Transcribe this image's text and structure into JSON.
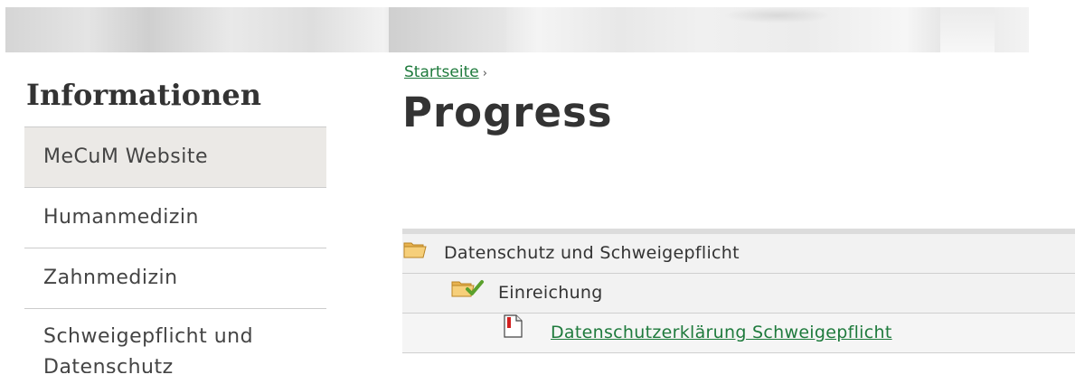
{
  "sidebar": {
    "heading": "Informationen",
    "items": [
      {
        "label": "MeCuM Website",
        "active": true
      },
      {
        "label": "Humanmedizin",
        "active": false
      },
      {
        "label": "Zahnmedizin",
        "active": false
      },
      {
        "label": "Schweigepflicht und Datenschutz",
        "active": false
      }
    ]
  },
  "breadcrumb": {
    "home": "Startseite",
    "separator": "›"
  },
  "page": {
    "title": "Progress"
  },
  "tree": {
    "rows": [
      {
        "label": "Datenschutz und Schweigepflicht",
        "icon": "folder-open-icon"
      },
      {
        "label": "Einreichung",
        "icon": "folder-check-icon"
      },
      {
        "label": "Datenschutzerklärung Schweigepflicht",
        "icon": "document-icon",
        "is_link": true
      }
    ]
  },
  "colors": {
    "link": "#1e7a3c",
    "text": "#333333",
    "active_bg": "#ebe9e6",
    "folder": "#f3c56b",
    "check": "#5aa02c",
    "doc_red": "#d22020"
  }
}
